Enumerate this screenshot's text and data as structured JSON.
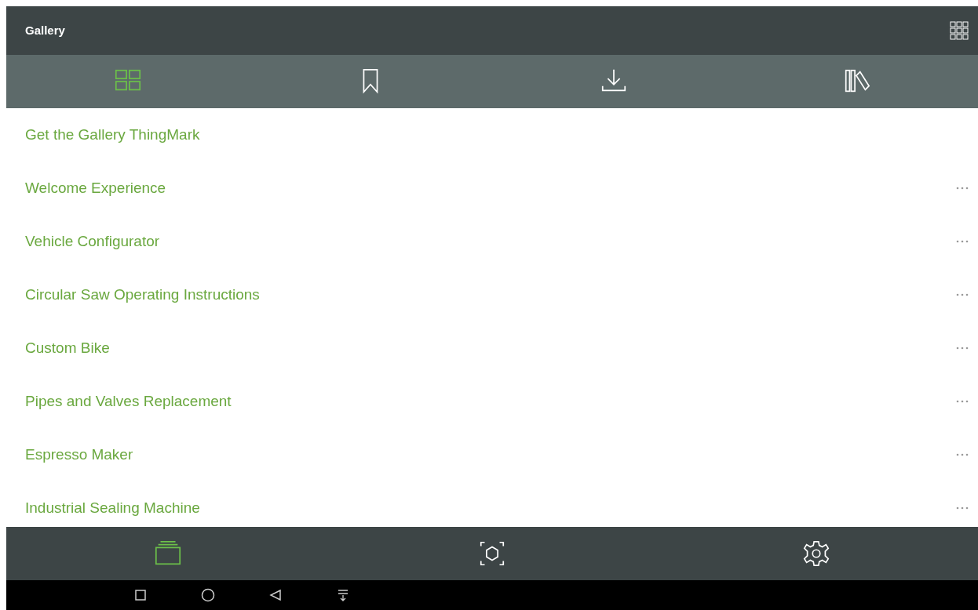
{
  "app_bar": {
    "title": "Gallery"
  },
  "tabs": [
    {
      "kind": "grid",
      "selected": true
    },
    {
      "kind": "bookmark",
      "selected": false
    },
    {
      "kind": "download",
      "selected": false
    },
    {
      "kind": "library",
      "selected": false
    }
  ],
  "items": [
    {
      "label": "Get the Gallery ThingMark",
      "more": false
    },
    {
      "label": "Welcome Experience",
      "more": true
    },
    {
      "label": "Vehicle Configurator",
      "more": true
    },
    {
      "label": "Circular Saw Operating Instructions",
      "more": true
    },
    {
      "label": "Custom Bike",
      "more": true
    },
    {
      "label": "Pipes and Valves Replacement",
      "more": true
    },
    {
      "label": "Espresso Maker",
      "more": true
    },
    {
      "label": "Industrial Sealing Machine",
      "more": true
    }
  ],
  "bottom_tabs": [
    {
      "kind": "stack",
      "selected": true
    },
    {
      "kind": "scan",
      "selected": false
    },
    {
      "kind": "settings",
      "selected": false
    }
  ]
}
